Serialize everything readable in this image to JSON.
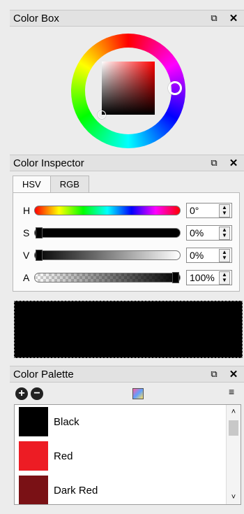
{
  "color_box": {
    "title": "Color Box"
  },
  "color_inspector": {
    "title": "Color Inspector",
    "tabs": [
      {
        "label": "HSV",
        "active": true
      },
      {
        "label": "RGB",
        "active": false
      }
    ],
    "rows": [
      {
        "label": "H",
        "value": "0°"
      },
      {
        "label": "S",
        "value": "0%"
      },
      {
        "label": "V",
        "value": "0%"
      },
      {
        "label": "A",
        "value": "100%"
      }
    ],
    "preview_color": "#000000"
  },
  "color_palette": {
    "title": "Color Palette",
    "items": [
      {
        "label": "Black",
        "color": "#000000"
      },
      {
        "label": "Red",
        "color": "#ed1c24"
      },
      {
        "label": "Dark Red",
        "color": "#7a1115"
      }
    ]
  },
  "icons": {
    "float": "float-panel-icon",
    "close": "close-icon",
    "add": "add-icon",
    "remove": "remove-icon",
    "palette": "palette-view-icon",
    "menu": "menu-icon"
  }
}
